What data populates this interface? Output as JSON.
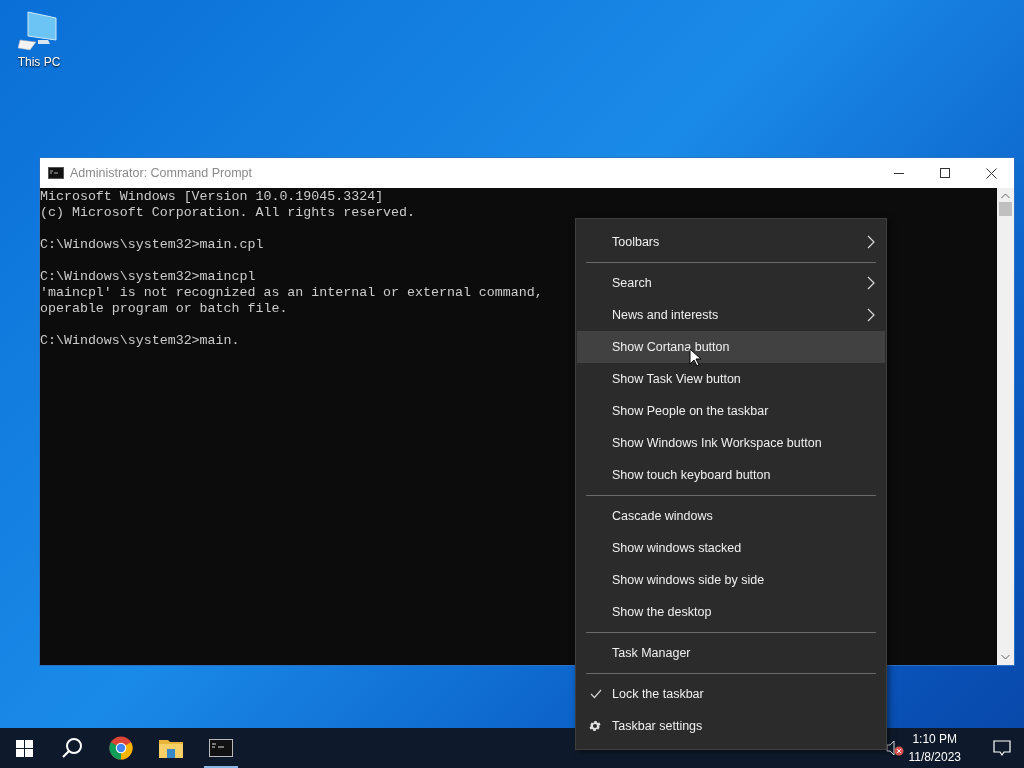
{
  "desktop_icons": [
    {
      "label": "This PC"
    }
  ],
  "window": {
    "title": "Administrator: Command Prompt",
    "blocks": [
      [
        "Microsoft Windows [Version 10.0.19045.3324]",
        "(c) Microsoft Corporation. All rights reserved."
      ],
      [
        "C:\\Windows\\system32>main.cpl"
      ],
      [
        "C:\\Windows\\system32>maincpl",
        "'maincpl' is not recognized as an internal or external command,",
        "operable program or batch file."
      ],
      [
        "C:\\Windows\\system32>main."
      ]
    ]
  },
  "context_menu": {
    "items": [
      {
        "kind": "command",
        "label": "Toolbars",
        "submenu": true,
        "selected": false,
        "checked": false
      },
      {
        "kind": "separator"
      },
      {
        "kind": "command",
        "label": "Search",
        "submenu": true,
        "selected": false,
        "checked": false
      },
      {
        "kind": "command",
        "label": "News and interests",
        "submenu": true,
        "selected": false,
        "checked": false
      },
      {
        "kind": "command",
        "label": "Show Cortana button",
        "submenu": false,
        "selected": true,
        "checked": false
      },
      {
        "kind": "command",
        "label": "Show Task View button",
        "submenu": false,
        "selected": false,
        "checked": false
      },
      {
        "kind": "command",
        "label": "Show People on the taskbar",
        "submenu": false,
        "selected": false,
        "checked": false
      },
      {
        "kind": "command",
        "label": "Show Windows Ink Workspace button",
        "submenu": false,
        "selected": false,
        "checked": false
      },
      {
        "kind": "command",
        "label": "Show touch keyboard button",
        "submenu": false,
        "selected": false,
        "checked": false
      },
      {
        "kind": "separator"
      },
      {
        "kind": "command",
        "label": "Cascade windows",
        "submenu": false,
        "selected": false,
        "checked": false
      },
      {
        "kind": "command",
        "label": "Show windows stacked",
        "submenu": false,
        "selected": false,
        "checked": false
      },
      {
        "kind": "command",
        "label": "Show windows side by side",
        "submenu": false,
        "selected": false,
        "checked": false
      },
      {
        "kind": "command",
        "label": "Show the desktop",
        "submenu": false,
        "selected": false,
        "checked": false
      },
      {
        "kind": "separator"
      },
      {
        "kind": "command",
        "label": "Task Manager",
        "submenu": false,
        "selected": false,
        "checked": false
      },
      {
        "kind": "separator"
      },
      {
        "kind": "command",
        "label": "Lock the taskbar",
        "submenu": false,
        "selected": false,
        "checked": true
      },
      {
        "kind": "settings",
        "label": "Taskbar settings",
        "submenu": false,
        "selected": false,
        "checked": false
      }
    ]
  },
  "taskbar": {
    "apps": [
      {
        "kind": "chrome",
        "running": false
      },
      {
        "kind": "folder",
        "running": false
      },
      {
        "kind": "terminal",
        "running": true
      }
    ],
    "time": "1:10 PM",
    "date": "11/8/2023"
  }
}
